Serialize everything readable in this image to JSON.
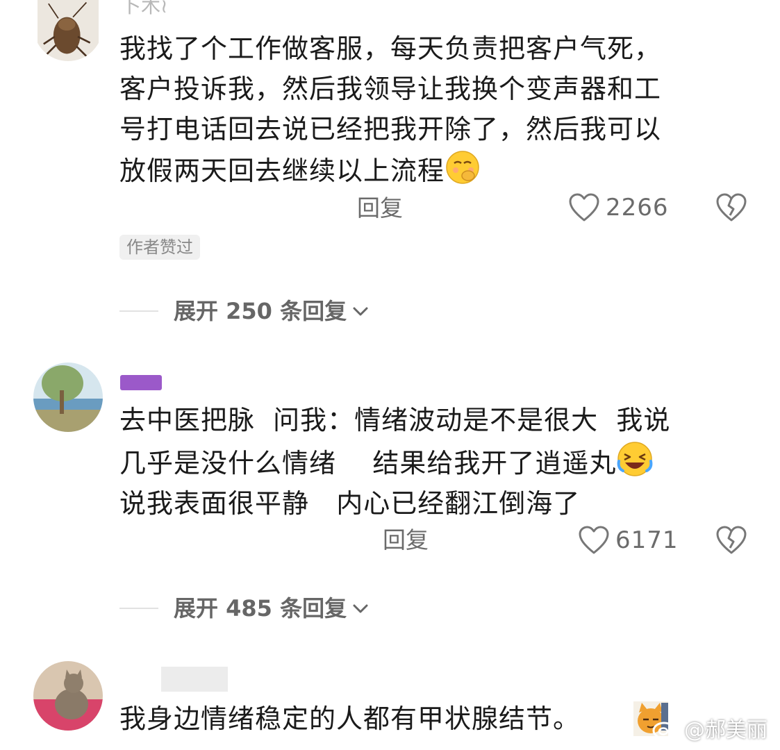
{
  "comments": [
    {
      "username": "卜木≀",
      "lines": [
        "我找了个工作做客服，每天负责把客户气死，",
        "客户投诉我，然后我领导让我换个变声器和工",
        "号打电话回去说已经把我开除了，然后我可以",
        "放假两天回去继续以上流程"
      ],
      "reply_label": "回复",
      "like_count": "2266",
      "author_liked": "作者赞过",
      "expand_label": "展开 250 条回复"
    },
    {
      "username": "",
      "lines": [
        "去中医把脉  问我：情绪波动是不是很大  我说",
        "几乎是没什么情绪    结果给我开了逍遥丸",
        "说我表面很平静   内心已经翻江倒海了"
      ],
      "reply_label": "回复",
      "like_count": "6171",
      "expand_label": "展开 485 条回复"
    },
    {
      "username": "",
      "lines": [
        "我身边情绪稳定的人都有甲状腺结节。"
      ]
    }
  ],
  "watermark": "@郝美丽",
  "icons": {
    "like": "heart-outline-icon",
    "dislike": "broken-heart-icon",
    "expand": "chevron-down-icon",
    "emoji_1": "shushing-face-emoji",
    "emoji_2": "rolling-laughing-emoji",
    "emoji_3": "cat-thinking-emoji",
    "watermark": "weibo-logo-icon"
  },
  "colors": {
    "text": "#1a1a1a",
    "secondary": "#6b6b6b",
    "username": "#b8b8b8",
    "username_redacted": "#9b59c9"
  }
}
